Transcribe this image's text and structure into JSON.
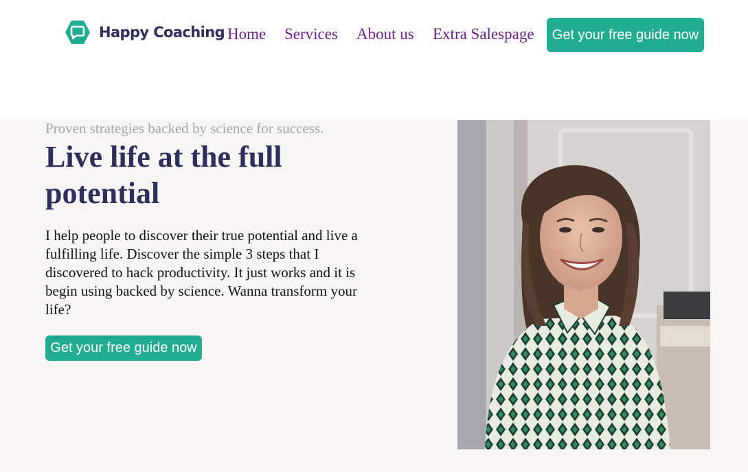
{
  "brand": {
    "name": "Happy Coaching",
    "accent": "#22ad92",
    "navy": "#2d2f5c",
    "nav_color": "#6a1f8a"
  },
  "nav": {
    "items": [
      {
        "label": "Home"
      },
      {
        "label": "Services"
      },
      {
        "label": "About us"
      },
      {
        "label": "Extra Salespage"
      }
    ],
    "cta_label": "Get your free guide now"
  },
  "hero": {
    "tagline": "Proven strategies backed by science for success.",
    "headline": "Live life at the full potential",
    "body": "I help people to discover their true potential and live a fulfilling life. Discover the simple 3 steps that I discovered to hack productivity. It just works and it is begin using backed by science. Wanna transform your life?",
    "cta_label": "Get your free guide now"
  },
  "icons": {
    "logo": "speech-bubble-logo-icon",
    "photo": "smiling-woman-portrait-image"
  }
}
